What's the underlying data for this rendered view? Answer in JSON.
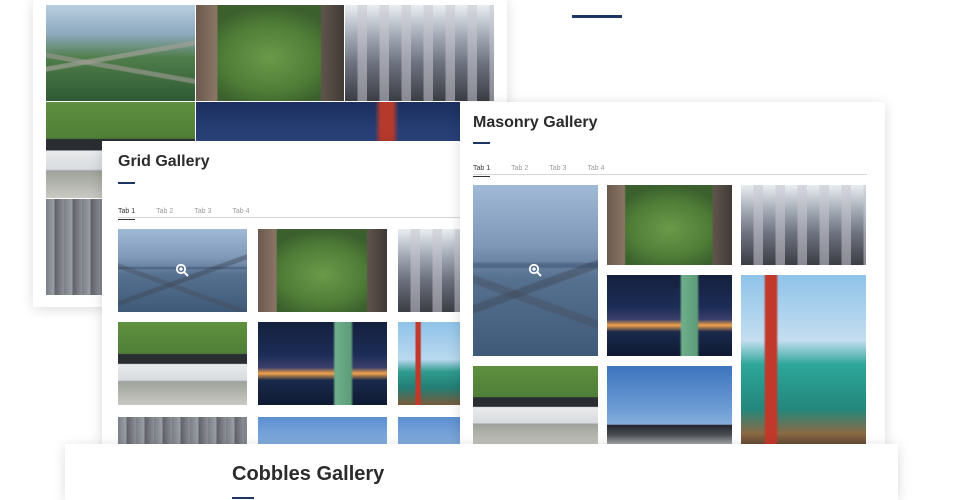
{
  "grid_gallery": {
    "title": "Grid Gallery",
    "tabs": [
      {
        "label": "Tab 1",
        "active": true
      },
      {
        "label": "Tab 2",
        "active": false
      },
      {
        "label": "Tab 3",
        "active": false
      },
      {
        "label": "Tab 4",
        "active": false
      }
    ]
  },
  "masonry_gallery": {
    "title": "Masonry Gallery",
    "tabs": [
      {
        "label": "Tab 1",
        "active": true
      },
      {
        "label": "Tab 2",
        "active": false
      },
      {
        "label": "Tab 3",
        "active": false
      },
      {
        "label": "Tab 4",
        "active": false
      }
    ]
  },
  "cobbles_gallery": {
    "title": "Cobbles Gallery"
  },
  "icons": {
    "zoom": "zoom-in-icon"
  },
  "colors": {
    "accent": "#1f3566",
    "title": "#2b2b2b",
    "tab_inactive": "#9b9b9b"
  }
}
